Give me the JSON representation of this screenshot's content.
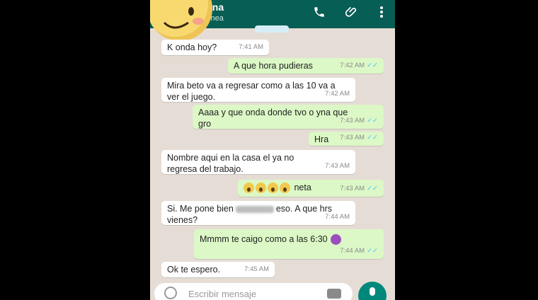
{
  "header": {
    "contact_name": "ana",
    "status": "línea"
  },
  "composer": {
    "placeholder": "Escribir mensaje"
  },
  "messages": [
    {
      "text": "K onda hoy?",
      "time": "7:41 AM"
    },
    {
      "text": "A que hora pudieras",
      "time": "7:42 AM"
    },
    {
      "text": "Mira beto va a regresar como a las 10 va a ver el juego.",
      "time": "7:42 AM"
    },
    {
      "text": "Aaaa y que onda donde tvo o yna que gro",
      "time": "7:43 AM"
    },
    {
      "text": "Hra",
      "time": "7:43 AM"
    },
    {
      "text": "Nombre aqui en la casa el ya no regresa del trabajo.",
      "time": "7:43 AM"
    },
    {
      "text": "neta",
      "time": "7:43 AM"
    },
    {
      "text_before": "Si. Me pone bien",
      "text_after": "eso. A que hrs vienes?",
      "time": "7:44 AM"
    },
    {
      "text": "Mmmm te caigo como a las 6:30",
      "time": "7:44 AM"
    },
    {
      "text": "Ok te espero.",
      "time": "7:45 AM"
    }
  ],
  "colors": {
    "header": "#075e54",
    "chat_bg": "#e5ddd5",
    "outgoing": "#dcf8c6",
    "incoming": "#ffffff",
    "read_ticks": "#4fc3f7"
  }
}
